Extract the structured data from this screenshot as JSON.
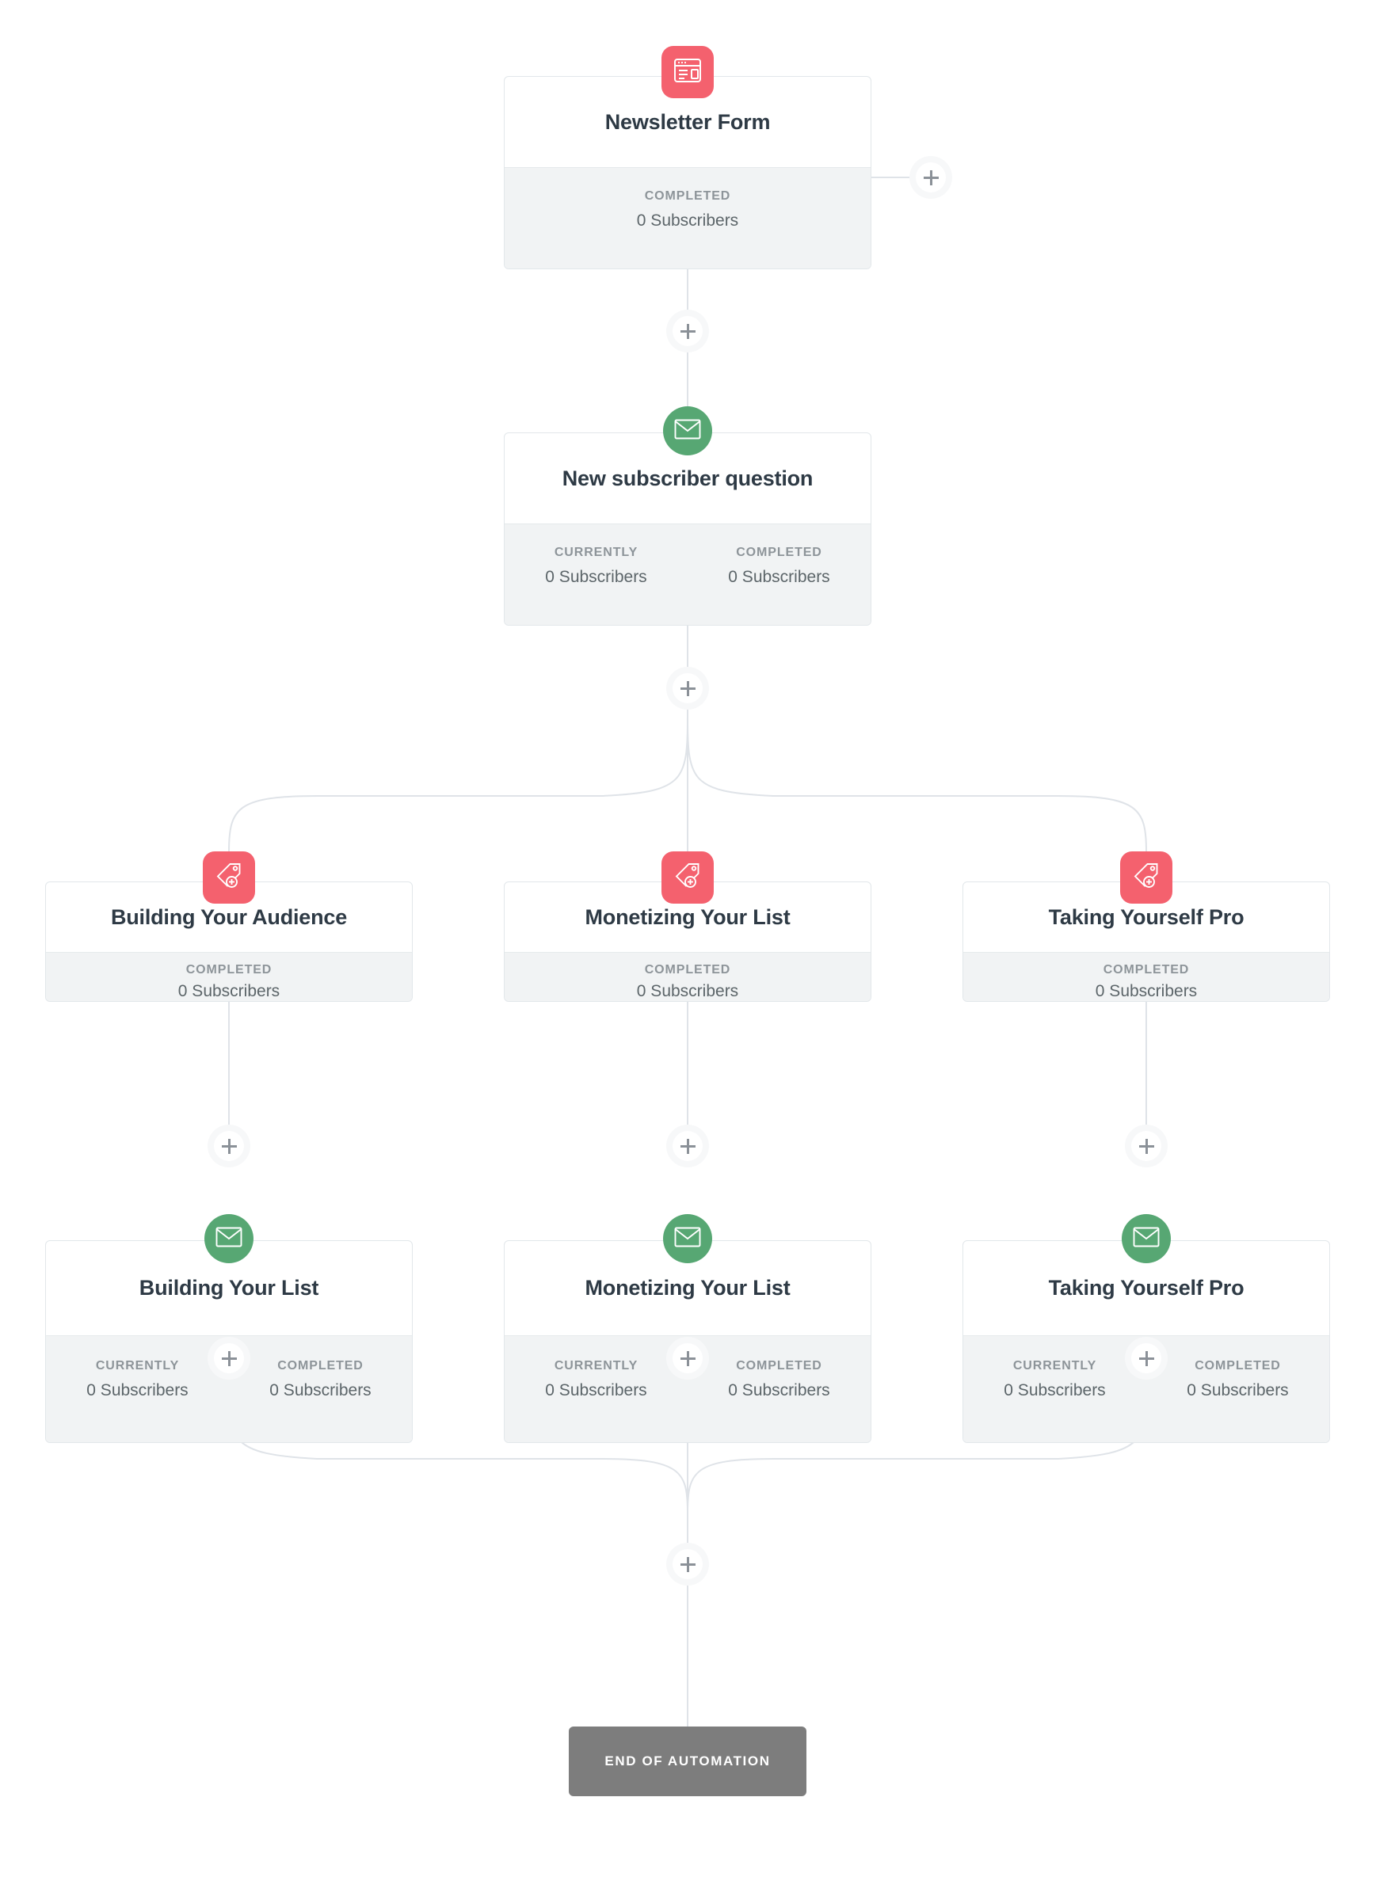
{
  "colors": {
    "accent_red": "#f4616e",
    "accent_green": "#57a773",
    "card_border": "#e2e7ea",
    "stats_bg": "#f1f3f4",
    "title_text": "#2e3a45",
    "label_text": "#8d9499",
    "value_text": "#5c6569",
    "wire": "#dfe3e8",
    "end_bar_bg": "#7d7d7d",
    "plus_glyph": "#8b9198"
  },
  "labels": {
    "currently": "CURRENTLY",
    "completed": "COMPLETED",
    "add_step": "+"
  },
  "nodes": {
    "form": {
      "title": "Newsletter Form",
      "icon": "browser-form-icon",
      "icon_kind": "square-red",
      "stats": [
        {
          "label": "COMPLETED",
          "value": "0 Subscribers"
        }
      ]
    },
    "question_email": {
      "title": "New subscriber question",
      "icon": "envelope-icon",
      "icon_kind": "circle-green",
      "stats": [
        {
          "label": "CURRENTLY",
          "value": "0 Subscribers"
        },
        {
          "label": "COMPLETED",
          "value": "0 Subscribers"
        }
      ]
    },
    "tag_left": {
      "title": "Building Your Audience",
      "icon": "tag-plus-icon",
      "icon_kind": "square-red",
      "stats": [
        {
          "label": "COMPLETED",
          "value": "0 Subscribers"
        }
      ]
    },
    "tag_center": {
      "title": "Monetizing Your List",
      "icon": "tag-plus-icon",
      "icon_kind": "square-red",
      "stats": [
        {
          "label": "COMPLETED",
          "value": "0 Subscribers"
        }
      ]
    },
    "tag_right": {
      "title": "Taking Yourself Pro",
      "icon": "tag-plus-icon",
      "icon_kind": "square-red",
      "stats": [
        {
          "label": "COMPLETED",
          "value": "0 Subscribers"
        }
      ]
    },
    "email_left": {
      "title": "Building Your List",
      "icon": "envelope-icon",
      "icon_kind": "circle-green",
      "stats": [
        {
          "label": "CURRENTLY",
          "value": "0 Subscribers"
        },
        {
          "label": "COMPLETED",
          "value": "0 Subscribers"
        }
      ]
    },
    "email_center": {
      "title": "Monetizing Your List",
      "icon": "envelope-icon",
      "icon_kind": "circle-green",
      "stats": [
        {
          "label": "CURRENTLY",
          "value": "0 Subscribers"
        },
        {
          "label": "COMPLETED",
          "value": "0 Subscribers"
        }
      ]
    },
    "email_right": {
      "title": "Taking Yourself Pro",
      "icon": "envelope-icon",
      "icon_kind": "circle-green",
      "stats": [
        {
          "label": "CURRENTLY",
          "value": "0 Subscribers"
        },
        {
          "label": "COMPLETED",
          "value": "0 Subscribers"
        }
      ]
    }
  },
  "end_of_automation": {
    "label": "END OF AUTOMATION"
  }
}
